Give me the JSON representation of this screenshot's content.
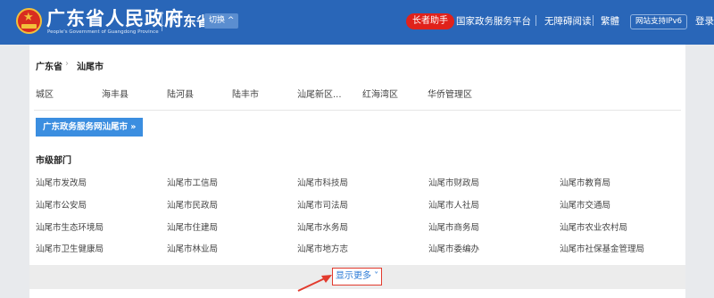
{
  "header": {
    "logo_title": "广东省人民政府",
    "logo_subtitle": "People's Government of Guangdong Province",
    "region": "广东省",
    "switch_label": "切换 ^",
    "elder_button": "长者助手",
    "links": [
      "国家政务服务平台",
      "无障碍阅读",
      "繁體"
    ],
    "ipv6_badge": "网站支持IPv6",
    "login": "登录"
  },
  "breadcrumb": {
    "province": "广东省",
    "separator": "›",
    "city": "汕尾市"
  },
  "counties": [
    "城区",
    "海丰县",
    "陆河县",
    "陆丰市",
    "汕尾新区...",
    "红海湾区",
    "华侨管理区"
  ],
  "portal_button": "广东政务服务网汕尾市 »",
  "section_title": "市级部门",
  "departments": [
    [
      "汕尾市发改局",
      "汕尾市工信局",
      "汕尾市科技局",
      "汕尾市财政局",
      "汕尾市教育局"
    ],
    [
      "汕尾市公安局",
      "汕尾市民政局",
      "汕尾市司法局",
      "汕尾市人社局",
      "汕尾市交通局"
    ],
    [
      "汕尾市生态环境局",
      "汕尾市住建局",
      "汕尾市水务局",
      "汕尾市商务局",
      "汕尾市农业农村局"
    ],
    [
      "汕尾市卫生健康局",
      "汕尾市林业局",
      "汕尾市地方志",
      "汕尾市委编办",
      "汕尾市社保基金管理局"
    ]
  ],
  "show_more": "显示更多 ˅",
  "colors": {
    "header_bg": "#2966b8",
    "elder_red": "#e0221b",
    "portal_blue": "#3b8ee0",
    "highlight_red": "#e23b2e"
  }
}
